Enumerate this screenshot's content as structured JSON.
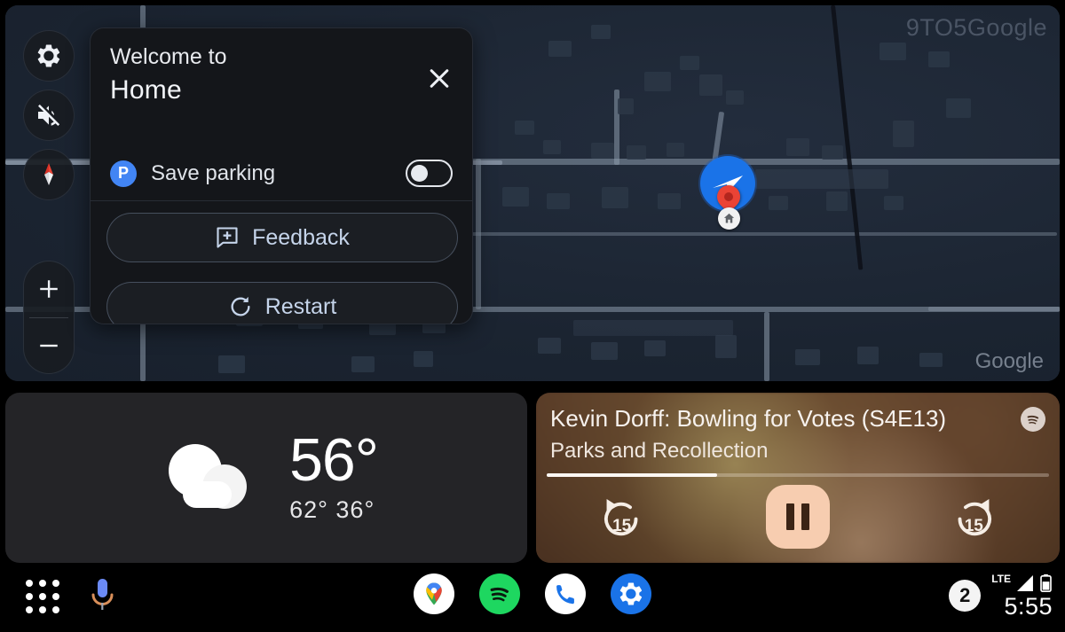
{
  "map": {
    "watermark": "9TO5Google",
    "attribution": "Google",
    "rail": [
      {
        "name": "settings",
        "icon": "gear-icon"
      },
      {
        "name": "mute",
        "icon": "speaker-muted-icon"
      },
      {
        "name": "compass",
        "icon": "compass-icon"
      }
    ],
    "zoom_in_label": "+",
    "zoom_out_label": "−",
    "markers": {
      "current_location": "navigation-arrow",
      "destination": "red-pin",
      "home": "home-icon"
    }
  },
  "dialog": {
    "line1": "Welcome to",
    "line2": "Home",
    "close_icon": "close-icon",
    "parking": {
      "badge": "P",
      "label": "Save parking",
      "toggle_state": "off"
    },
    "buttons": [
      {
        "label": "Feedback",
        "icon": "feedback-icon"
      },
      {
        "label": "Restart",
        "icon": "restart-icon"
      }
    ]
  },
  "weather": {
    "icon": "cloud-icon",
    "temperature": "56°",
    "high": "62°",
    "low": "36°",
    "high_low": "62° 36°"
  },
  "media": {
    "title": "Kevin Dorff: Bowling for Votes (S4E13)",
    "subtitle": "Parks and Recollection",
    "app_icon": "spotify-icon",
    "progress_percent": 34,
    "rewind_label": "15",
    "forward_label": "15",
    "play_state": "playing",
    "play_icon": "pause-icon"
  },
  "bottom_bar": {
    "app_grid_icon": "apps-grid-icon",
    "assistant_icon": "microphone-icon",
    "apps": [
      {
        "name": "maps",
        "icon": "google-maps-icon"
      },
      {
        "name": "spotify",
        "icon": "spotify-icon"
      },
      {
        "name": "phone",
        "icon": "phone-icon"
      },
      {
        "name": "settings",
        "icon": "settings-gear-icon"
      }
    ],
    "notification_count": "2",
    "network_label": "LTE",
    "signal_icon": "signal-bars-icon",
    "battery_icon": "battery-icon",
    "time": "5:55"
  },
  "colors": {
    "accent_blue": "#1a73e8",
    "parking_blue": "#4285f4",
    "pin_red": "#ea4335",
    "spotify_green": "#1ed760",
    "media_accent": "#f7cdb0",
    "map_bg": "#1c2533"
  }
}
